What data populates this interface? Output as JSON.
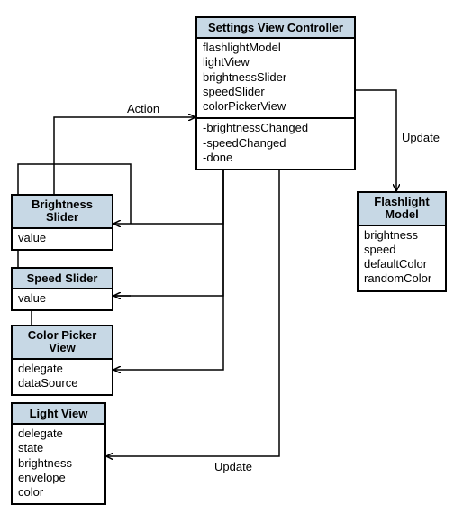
{
  "labels": {
    "action": "Action",
    "update": "Update"
  },
  "boxes": {
    "svc": {
      "title": "Settings View Controller",
      "attrs": [
        "flashlightModel",
        "lightView",
        "brightnessSlider",
        "speedSlider",
        "colorPickerView"
      ],
      "methods": [
        "-brightnessChanged",
        "-speedChanged",
        "-done"
      ]
    },
    "fm": {
      "title1": "Flashlight",
      "title2": "Model",
      "attrs": [
        "brightness",
        "speed",
        "defaultColor",
        "randomColor"
      ]
    },
    "bs": {
      "title1": "Brightness",
      "title2": "Slider",
      "attrs": [
        "value"
      ]
    },
    "ss": {
      "title": "Speed Slider",
      "attrs": [
        "value"
      ]
    },
    "cp": {
      "title1": "Color Picker",
      "title2": "View",
      "attrs": [
        "delegate",
        "dataSource"
      ]
    },
    "lv": {
      "title": "Light View",
      "attrs": [
        "delegate",
        "state",
        "brightness",
        "envelope",
        "color"
      ]
    }
  }
}
